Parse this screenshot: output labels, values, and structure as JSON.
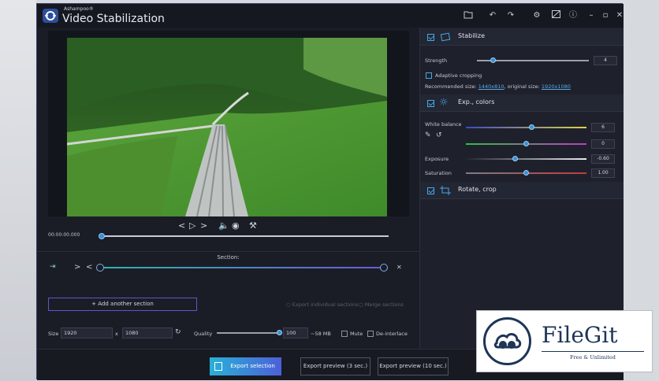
{
  "app": {
    "brand": "Ashampoo®",
    "title": "Video Stabilization"
  },
  "player": {
    "timecode": "00:00:00.000"
  },
  "section": {
    "label": "Section:",
    "add_label": "+ Add another section",
    "export_individual_label": "Export individual sections",
    "merge_label": "Merge sections"
  },
  "output": {
    "size_label": "Size",
    "width": "1920",
    "times": "x",
    "height": "1080",
    "quality_label": "Quality",
    "quality_value": "100",
    "quality_level": 1.0,
    "size_estimate": "~58 MB",
    "mute_label": "Mute",
    "deinterlace_label": "De-interlace"
  },
  "stabilize": {
    "title": "Stabilize",
    "strength_label": "Strength",
    "strength_value": "4",
    "strength_level": 0.15,
    "adaptive_label": "Adaptive cropping",
    "recommended_label": "Recommended size:",
    "recommended_value": "1440x810",
    "original_label": ", original size:",
    "original_value": "1920x1080"
  },
  "colors": {
    "title": "Exp., colors",
    "white_balance_label": "White balance",
    "wb_value_1": "6",
    "wb_level_1": 0.55,
    "wb_value_2": "0",
    "wb_level_2": 0.5,
    "exposure_label": "Exposure",
    "exposure_value": "-0.60",
    "exposure_level": 0.41,
    "saturation_label": "Saturation",
    "saturation_value": "1.00",
    "saturation_level": 0.5
  },
  "rotate": {
    "title": "Rotate, crop"
  },
  "footer": {
    "export_selection": "Export selection",
    "export_preview_3": "Export preview (3 sec.)",
    "export_preview_10": "Export preview (10 sec.)"
  },
  "watermark": {
    "name": "FileGit",
    "tagline": "Free & Unlimited"
  },
  "colors_palette": {
    "accent": "#3a8fd8",
    "background": "#1b1d26",
    "primary_button": "#2ab0d8"
  }
}
